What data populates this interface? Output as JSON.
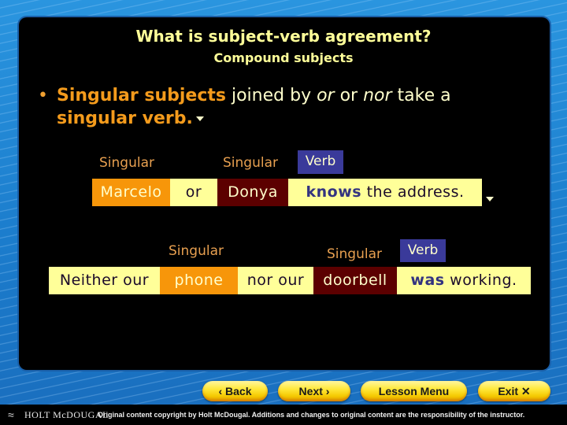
{
  "header": {
    "title": "What is subject-verb agreement?",
    "subtitle": "Compound subjects"
  },
  "bullet": {
    "marker": "•",
    "part1_bold": "Singular subjects",
    "part2": " joined by ",
    "part3_italic": "or",
    "part4": " or ",
    "part5_italic": "nor",
    "part6": " take a ",
    "part7_bold": "singular verb.",
    "more_icon": "dropdown-arrow-icon"
  },
  "example1": {
    "labels": {
      "subject1": "Singular",
      "subject2": "Singular",
      "verb": "Verb"
    },
    "segments": [
      {
        "text": "Marcelo",
        "role": "subject"
      },
      {
        "text": "or",
        "role": "conjunction"
      },
      {
        "text": "Donya",
        "role": "subject"
      },
      {
        "verb": "knows",
        "rest": " the address.",
        "role": "predicate"
      }
    ]
  },
  "example2": {
    "labels": {
      "subject1": "Singular",
      "subject2": "Singular",
      "verb": "Verb"
    },
    "segments": [
      {
        "text": "Neither our",
        "role": "conjunction"
      },
      {
        "text": "phone",
        "role": "subject"
      },
      {
        "text": "nor our",
        "role": "conjunction"
      },
      {
        "text": "doorbell",
        "role": "subject"
      },
      {
        "verb": "was",
        "rest": " working.",
        "role": "predicate"
      }
    ]
  },
  "nav": {
    "back": "‹ Back",
    "next": "Next ›",
    "menu": "Lesson Menu",
    "exit": "Exit ✕"
  },
  "footer": {
    "logo_icon": "dolphin-logo-icon",
    "logo_text": "HOLT McDOUGAL",
    "copyright": "Original content copyright by Holt McDougal. Additions and changes to original content are the responsibility of the instructor."
  },
  "colors": {
    "subject_orange": "#f7960a",
    "subject_maroon": "#5c0000",
    "sentence_yellow": "#ffff99",
    "verb_badge": "#3a3a9a",
    "title_yellow": "#ffff99",
    "highlight_orange": "#f49b1c"
  }
}
